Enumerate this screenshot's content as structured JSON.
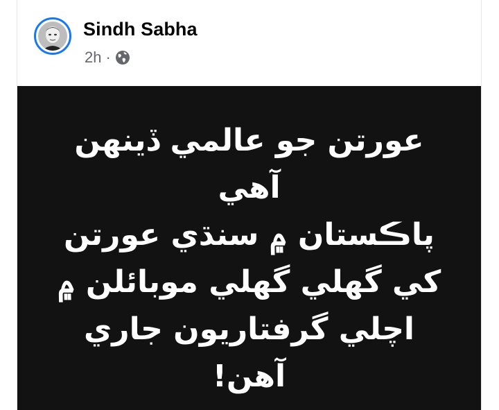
{
  "post": {
    "author": "Sindh Sabha",
    "time": "2h",
    "separator": "·",
    "privacy_icon": "globe-icon",
    "avatar_icon": "profile-photo",
    "text_lines": [
      "عورتن جو عالمي ڏينهن",
      "آهي",
      "پاڪستان ۾ سنڌي عورتن",
      "کي گهلي گهلي موبائلن ۾",
      "اچلي گرفتاريون جاري",
      "آهن!"
    ]
  },
  "colors": {
    "accent": "#1877f2",
    "name_text": "#050505",
    "meta_text": "#65676b",
    "image_bg": "#121212",
    "image_text": "#ffffff"
  }
}
